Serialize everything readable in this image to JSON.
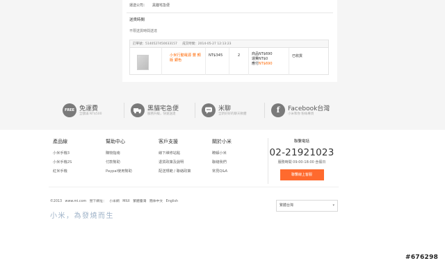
{
  "order": {
    "shipping_label": "運送公司：",
    "shipping_value": "黑貓宅急便",
    "delivery_title": "送貨時間",
    "delivery_note": "不限送貨時間送達",
    "order_no": "訂單號：5140527450033157",
    "order_time": "成交時間：2014-05-27 12:13:23",
    "product_name": "小米行動電源 豐 顏版 銀色",
    "price": "NT$345",
    "qty": "2",
    "sum_label": "商品",
    "sum_value": "NT$690",
    "shipping_fee_label": "運費",
    "shipping_fee_value": "NT$0",
    "paid_label": "應付",
    "paid_value": "NT$690",
    "status": "已收貨"
  },
  "services": [
    {
      "icon": "FREE",
      "title": "免運費",
      "sub": "全額滿 NT$500"
    },
    {
      "icon": "truck",
      "title": "黑貓宅急便",
      "sub": "服務升級，快速送達"
    },
    {
      "icon": "chat",
      "title": "米聊",
      "sub": "全新好好的聊天軟體"
    },
    {
      "icon": "f",
      "title": "Facebook台灣",
      "sub": "小米和你 粉絲專頁"
    }
  ],
  "footer": {
    "columns": [
      {
        "title": "產品線",
        "items": [
          "小米手機3",
          "小米手機2S",
          "紅米手機"
        ]
      },
      {
        "title": "幫助中心",
        "items": [
          "購物指南",
          "付款幫助",
          "Paypal使用幫助"
        ]
      },
      {
        "title": "客戶支援",
        "items": [
          "線下維修站點",
          "退貨政策及說明",
          "配送規範 / 聯絡政策"
        ]
      },
      {
        "title": "關於小米",
        "items": [
          "瞭解小米",
          "聯絡我們",
          "常見Q&A"
        ]
      }
    ],
    "contact_label": "聯繫電話",
    "phone": "02-21921023",
    "hours": "服務時間 09:00-18:00 含假日",
    "online_button": "聯繫線上客服",
    "copyright_items": [
      "©2013",
      "www.mi.com",
      "營下網址：",
      "小米網",
      "MIUI",
      "繁體臺灣",
      "簡体中文",
      "English"
    ],
    "slogan": "小米，為發燒而生",
    "region": "繁體台灣"
  },
  "watermark": "#676298"
}
